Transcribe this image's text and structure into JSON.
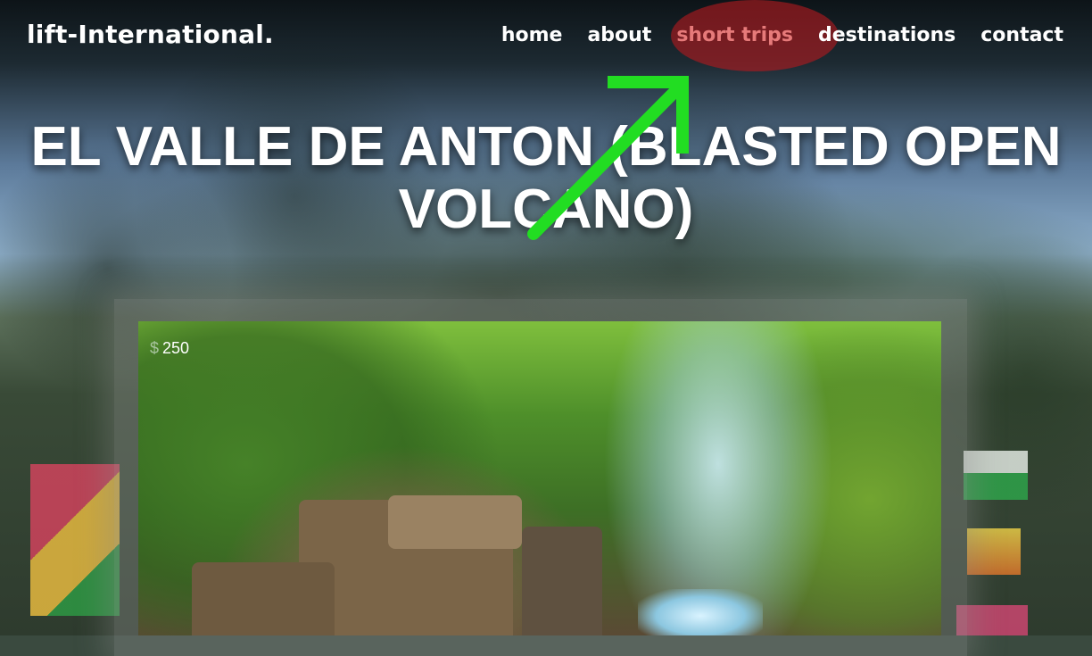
{
  "logo": {
    "text": "lift-International."
  },
  "nav": {
    "items": [
      {
        "label": "home",
        "active": false
      },
      {
        "label": "about",
        "active": false
      },
      {
        "label": "short trips",
        "active": true
      },
      {
        "label": "destinations",
        "active": false
      },
      {
        "label": "contact",
        "active": false
      }
    ]
  },
  "hero": {
    "title_line1": "EL VALLE DE ANTON (BLASTED OPEN",
    "title_line2": "VOLCANO)"
  },
  "card": {
    "currency_icon": "dollar-icon",
    "currency_symbol": "$",
    "price": "250"
  },
  "colors": {
    "nav_active": "#e67a7a",
    "highlight": "#b21a1e",
    "annotation_arrow": "#22dd22"
  }
}
